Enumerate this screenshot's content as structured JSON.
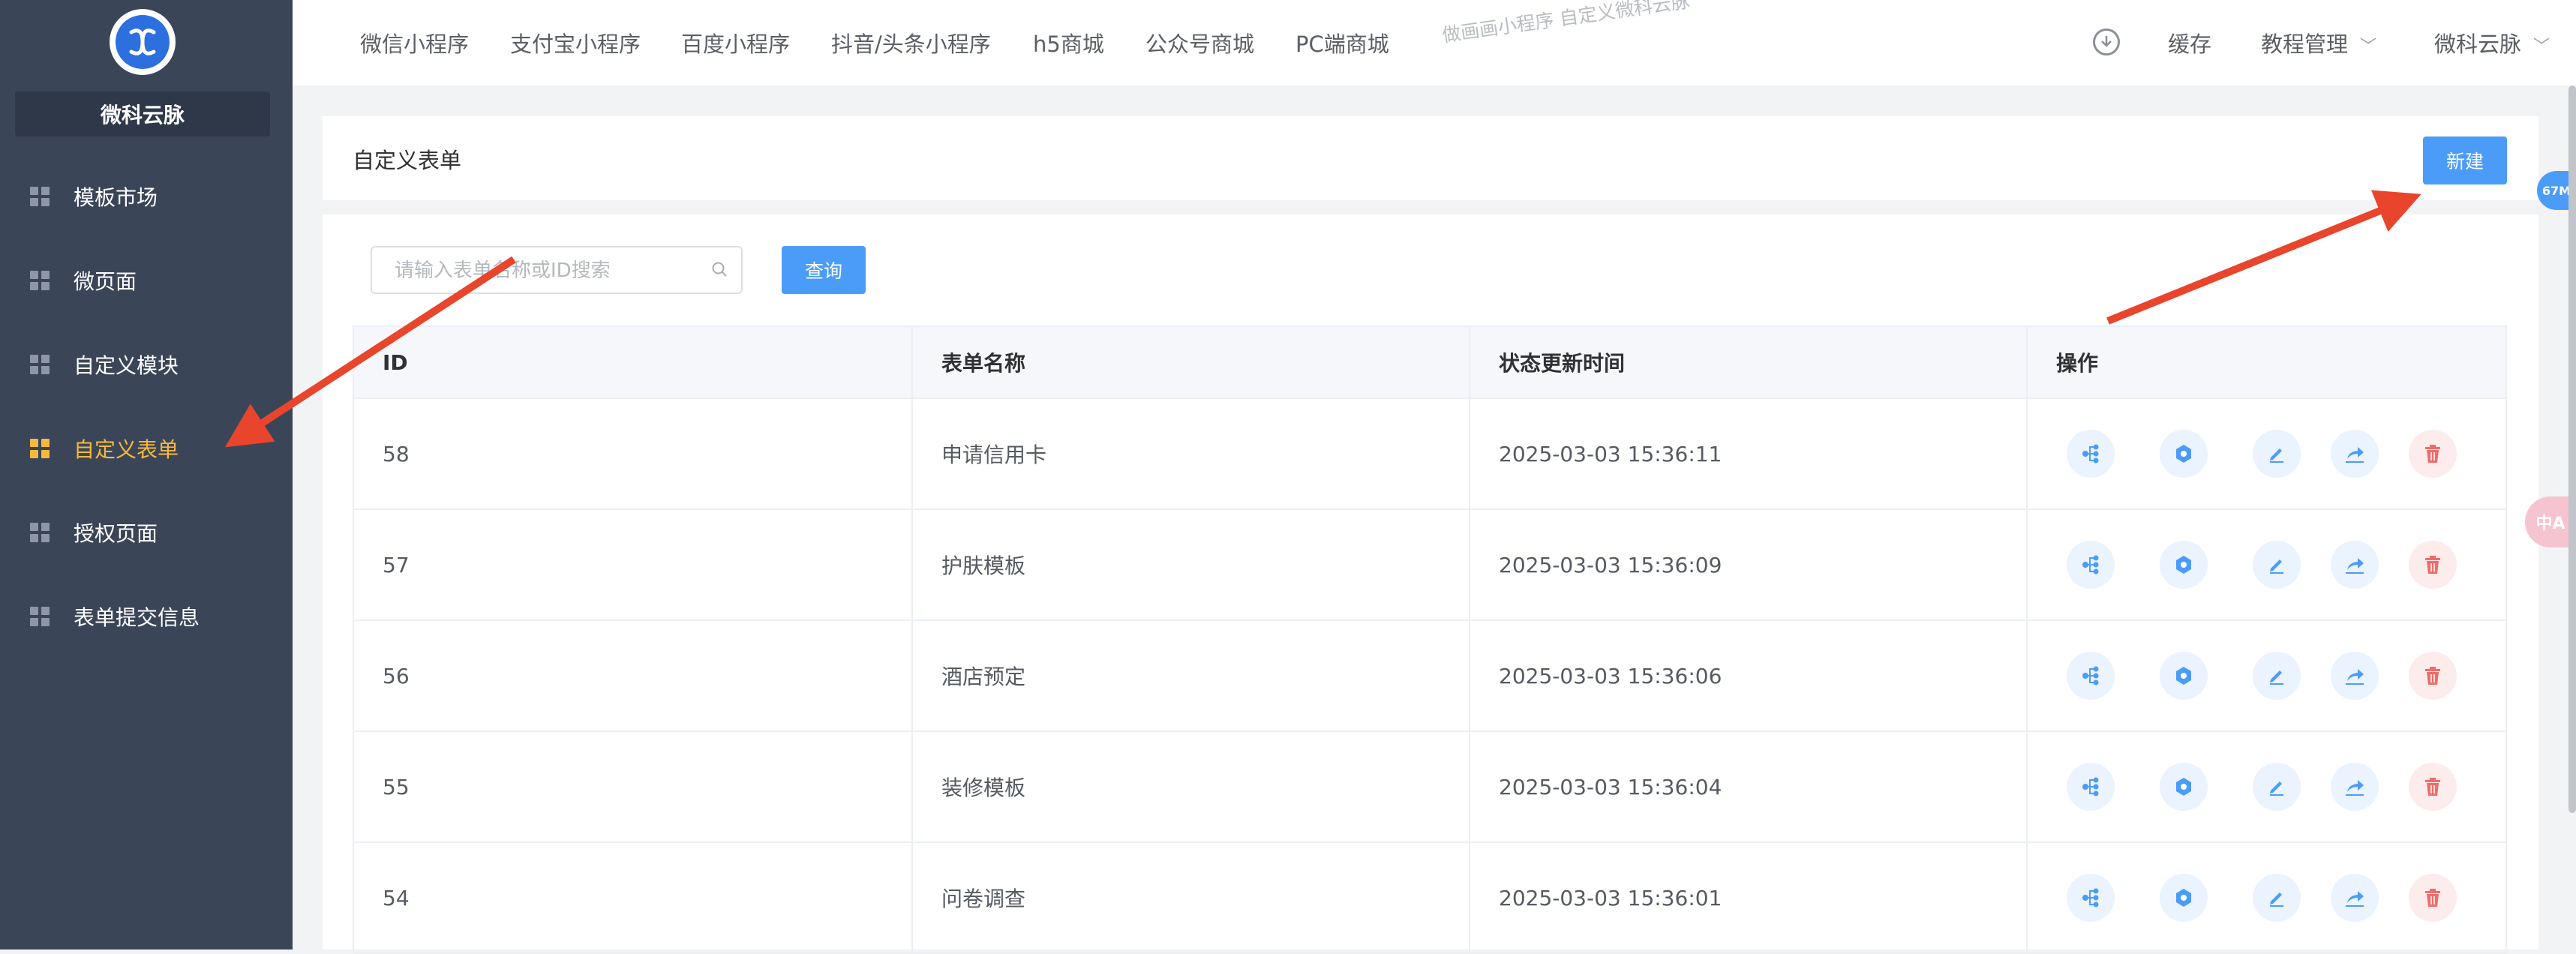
{
  "brand": {
    "name": "微科云脉"
  },
  "sidebar": {
    "items": [
      {
        "label": "模板市场",
        "active": false
      },
      {
        "label": "微页面",
        "active": false
      },
      {
        "label": "自定义模块",
        "active": false
      },
      {
        "label": "自定义表单",
        "active": true
      },
      {
        "label": "授权页面",
        "active": false
      },
      {
        "label": "表单提交信息",
        "active": false
      }
    ]
  },
  "topbar": {
    "tabs": [
      "微信小程序",
      "支付宝小程序",
      "百度小程序",
      "抖音/头条小程序",
      "h5商城",
      "公众号商城",
      "PC端商城"
    ],
    "watermark": "做画画小程序 自定义微科云脉",
    "cache_label": "缓存",
    "tutorial_label": "教程管理",
    "user_label": "微科云脉"
  },
  "header": {
    "title": "自定义表单",
    "new_button": "新建"
  },
  "search": {
    "placeholder": "请输入表单名称或ID搜索",
    "query_button": "查询"
  },
  "table": {
    "headers": [
      "ID",
      "表单名称",
      "状态更新时间",
      "操作"
    ],
    "rows": [
      {
        "id": "58",
        "name": "申请信用卡",
        "time": "2025-03-03 15:36:11"
      },
      {
        "id": "57",
        "name": "护肤模板",
        "time": "2025-03-03 15:36:09"
      },
      {
        "id": "56",
        "name": "酒店预定",
        "time": "2025-03-03 15:36:06"
      },
      {
        "id": "55",
        "name": "装修模板",
        "time": "2025-03-03 15:36:04"
      },
      {
        "id": "54",
        "name": "问卷调查",
        "time": "2025-03-03 15:36:01"
      }
    ],
    "actions": [
      "flow-icon",
      "settings-hex-icon",
      "edit-icon",
      "share-icon",
      "delete-icon"
    ]
  },
  "float_badge": "67M",
  "translate_label": "中A",
  "colors": {
    "sidebar_bg": "#3b4558",
    "accent_active": "#f5b93d",
    "primary": "#4b9cf8",
    "danger": "#f06b6b",
    "arrow": "#e8452c"
  }
}
